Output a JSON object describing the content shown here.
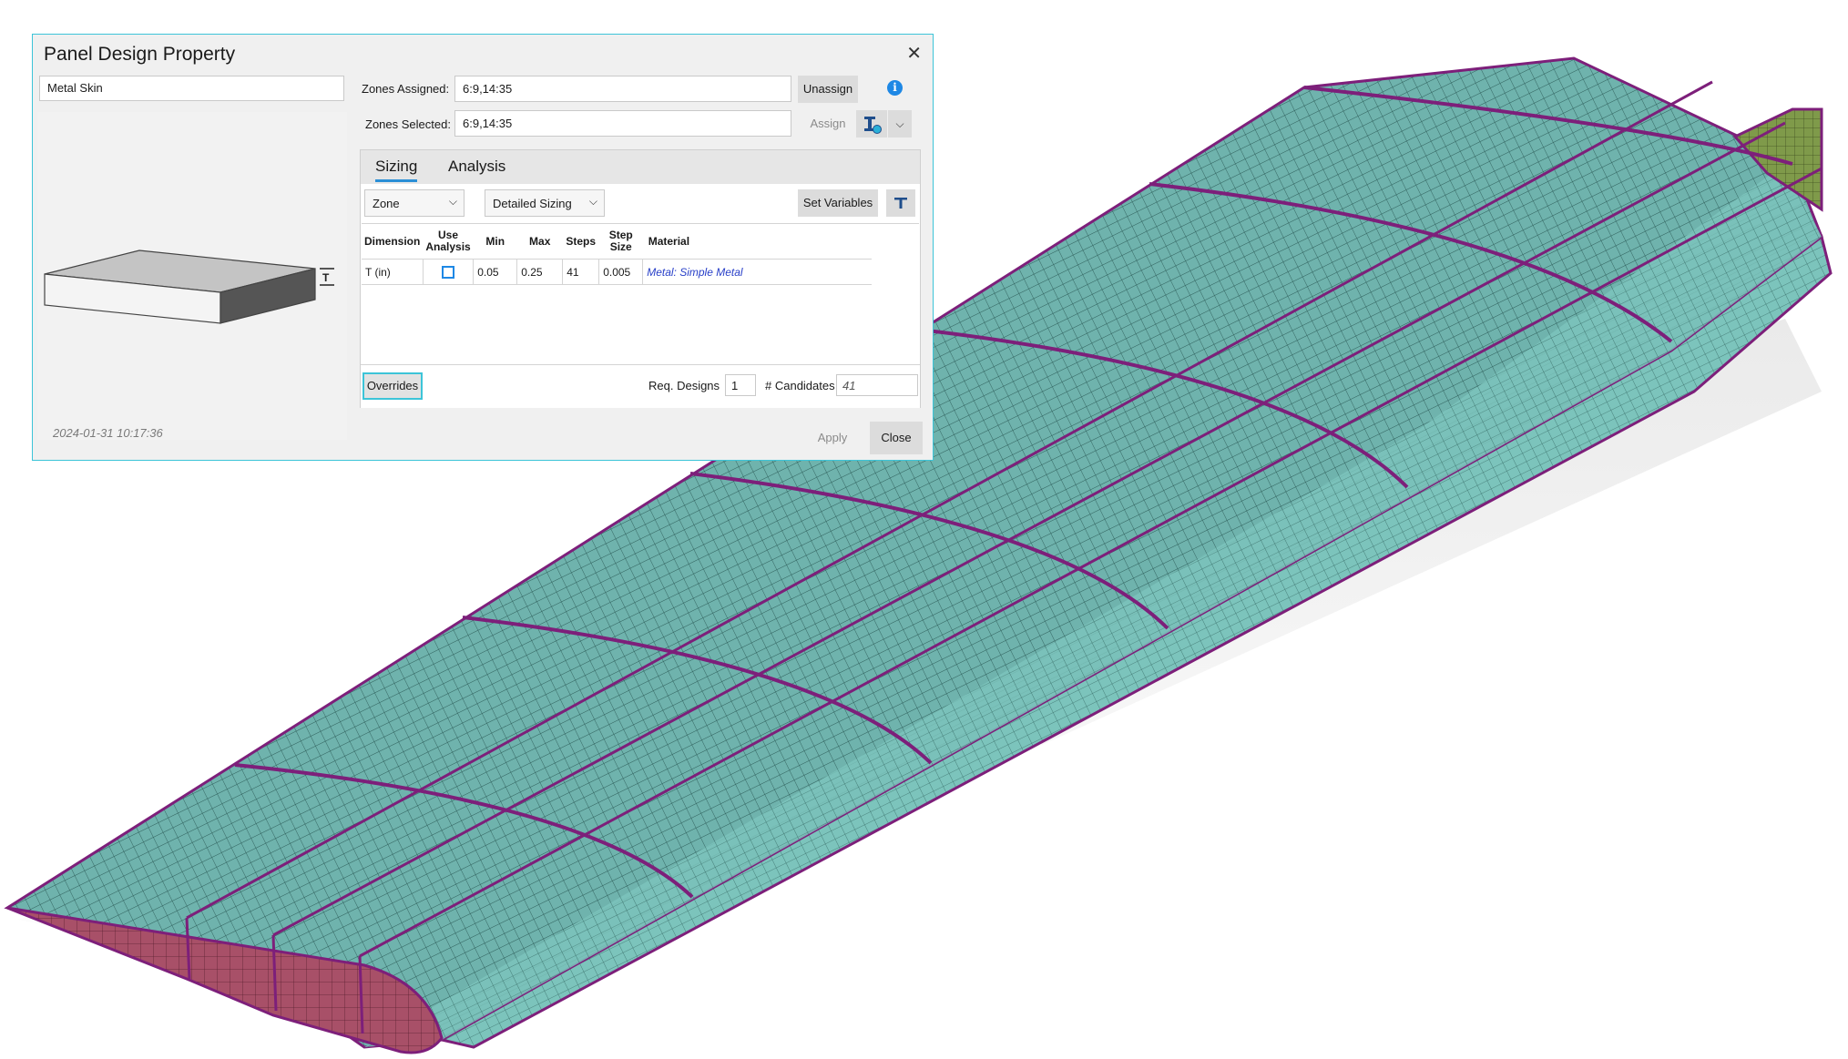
{
  "dialog": {
    "title": "Panel Design Property",
    "close_icon": "close-icon",
    "property_name": "Metal Skin",
    "zones_assigned_label": "Zones Assigned:",
    "zones_assigned_value": "6:9,14:35",
    "zones_selected_label": "Zones Selected:",
    "zones_selected_value": "6:9,14:35",
    "unassign_label": "Unassign",
    "assign_label": "Assign",
    "info_icon": "info-icon",
    "tool_icon": "zone-tool-icon",
    "preview_dimension_label": "T",
    "timestamp": "2024-01-31 10:17:36",
    "apply_label": "Apply",
    "close_label": "Close"
  },
  "tabs": [
    {
      "label": "Sizing",
      "active": true
    },
    {
      "label": "Analysis",
      "active": false
    }
  ],
  "sizing": {
    "scope_select": "Zone",
    "mode_select": "Detailed Sizing",
    "set_variables_label": "Set Variables",
    "columns": [
      "Dimension",
      "Use Analysis",
      "Min",
      "Max",
      "Steps",
      "Step Size",
      "Material"
    ],
    "rows": [
      {
        "dimension": "T (in)",
        "use_analysis": false,
        "min": "0.05",
        "max": "0.25",
        "steps": "41",
        "step_size": "0.005",
        "material": "Metal: Simple Metal"
      }
    ],
    "overrides_label": "Overrides",
    "req_designs_label": "Req. Designs",
    "req_designs_value": "1",
    "candidates_label": "# Candidates",
    "candidates_value": "41"
  },
  "colors": {
    "accent": "#3cc4d8",
    "skin": "#6fb3ad",
    "rib": "#7d1f7a",
    "rib_face": "#a85068",
    "tip_face": "#7f9a4a"
  }
}
